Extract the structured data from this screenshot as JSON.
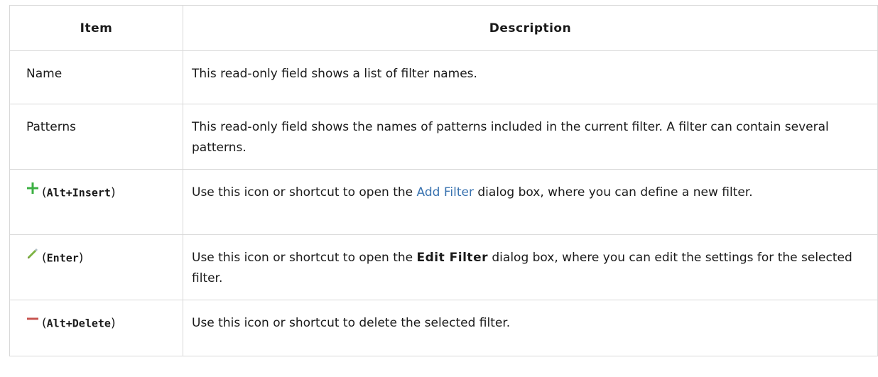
{
  "table": {
    "headers": {
      "item": "Item",
      "description": "Description"
    },
    "rows": [
      {
        "item": "Name",
        "description": "This read-only field shows a list of filter names."
      },
      {
        "item": "Patterns",
        "description": "This read-only field shows the names of patterns included in the current filter. A filter can contain several patterns."
      },
      {
        "icon": "plus-icon",
        "shortcut": "Alt+Insert",
        "desc_before": "Use this icon or shortcut to open the ",
        "desc_link": "Add Filter",
        "desc_after": " dialog box, where you can define a new filter."
      },
      {
        "icon": "pencil-icon",
        "shortcut": "Enter",
        "desc_before": "Use this icon or shortcut to open the ",
        "desc_bold": "Edit Filter",
        "desc_after": " dialog box, where you can edit the settings for the selected filter."
      },
      {
        "icon": "minus-icon",
        "shortcut": "Alt+Delete",
        "description": "Use this icon or shortcut to delete the selected filter."
      }
    ]
  },
  "colors": {
    "link": "#3a73b0",
    "plus": "#3cb043",
    "minus": "#c75450",
    "border": "#d9d9d9"
  }
}
